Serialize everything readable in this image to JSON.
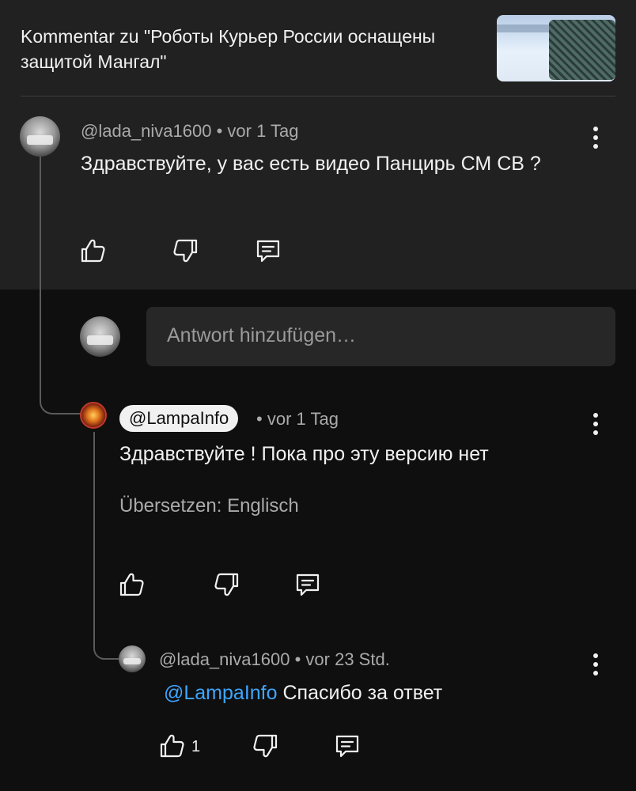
{
  "header": {
    "title": "Kommentar zu \"Роботы Курьер России оснащены защитой Мангал\""
  },
  "comment": {
    "author": "@lada_niva1600",
    "separator": "•",
    "time": "vor 1 Tag",
    "text": "Здравствуйте, у вас есть видео Панцирь СМ СВ ?"
  },
  "reply_input": {
    "placeholder": "Antwort hinzufügen…"
  },
  "reply1": {
    "author": "@LampaInfo",
    "separator": "•",
    "time": "vor 1 Tag",
    "text": "Здравствуйте ! Пока про эту версию нет",
    "translate": "Übersetzen: Englisch"
  },
  "reply2": {
    "author": "@lada_niva1600",
    "separator": "•",
    "time": "vor 23 Std.",
    "mention": "@LampaInfo",
    "text": "Спасибо за ответ",
    "likes": "1"
  },
  "icons": {
    "like": "thumbs-up-icon",
    "dislike": "thumbs-down-icon",
    "reply": "comment-icon",
    "more": "more-vert-icon"
  },
  "colors": {
    "background": "#0f0f0f",
    "panel": "#212121",
    "link": "#3ea6ff"
  }
}
